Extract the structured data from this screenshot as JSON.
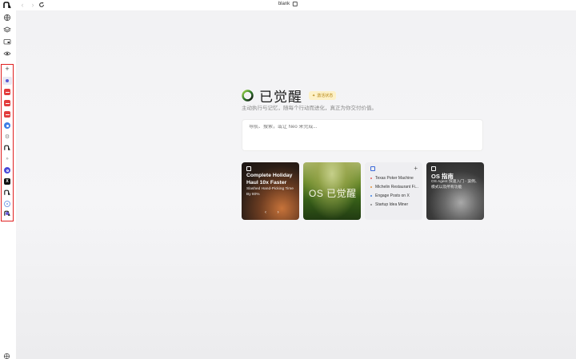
{
  "topbar": {
    "tab_title": "blank"
  },
  "sidebar": {
    "top_icons": [
      "globe-icon",
      "layers-icon",
      "folder-icon",
      "eye-icon"
    ],
    "add_label": "+",
    "apps": [
      {
        "name": "app-neo-active",
        "color": "#5b5bd6"
      },
      {
        "name": "app-red-1",
        "color": "#e23c3c"
      },
      {
        "name": "app-red-2",
        "color": "#e23c3c"
      },
      {
        "name": "app-red-3",
        "color": "#e23c3c"
      },
      {
        "name": "app-blue-1",
        "color": "#3f7fe6"
      },
      {
        "name": "app-gear",
        "color": "#888888"
      },
      {
        "name": "app-neo-logo-1",
        "color": "#222222"
      },
      {
        "name": "app-chevron",
        "color": "#888888"
      },
      {
        "name": "app-blue-2",
        "color": "#4a4ad8"
      },
      {
        "name": "app-x",
        "color": "#111111"
      },
      {
        "name": "app-neo-logo-2",
        "color": "#222222"
      },
      {
        "name": "app-blue-3",
        "color": "#7fa0e6"
      },
      {
        "name": "app-neo-logo-3",
        "color": "#222222"
      },
      {
        "name": "app-purple",
        "color": "#6a5ad8"
      }
    ]
  },
  "hero": {
    "title": "已觉醒",
    "badge": "激活状态",
    "subtitle": "主动执行与记忆，随每个行动而进化，真正为你交付价值。"
  },
  "search": {
    "placeholder": "导航、搜索，或让 Neo 来完成..."
  },
  "cards": {
    "holiday": {
      "title": "Complete Holiday Haul 10x Faster",
      "desc": "Slashed Hand-Picking Time By 80%",
      "arrows": "‹ ›"
    },
    "awakened": {
      "title": "OS 已觉醒"
    },
    "tasks": {
      "plus": "+",
      "items": [
        {
          "label": "Texas Poker Machine",
          "color": "#e25c5c"
        },
        {
          "label": "Michelin Restaurant Fi...",
          "color": "#e2913c"
        },
        {
          "label": "Engage Posts on X",
          "color": "#3c7fe2"
        },
        {
          "label": "Startup Idea Miner",
          "color": "#888888"
        }
      ]
    },
    "guide": {
      "title": "OS 指南",
      "desc": "OS Agent 快速入门 - 案例、模式以及所有功能"
    }
  },
  "colors": {
    "accent": "#5b5bd6",
    "badge_bg": "#fdf1c8",
    "highlight_border": "#e02020"
  }
}
